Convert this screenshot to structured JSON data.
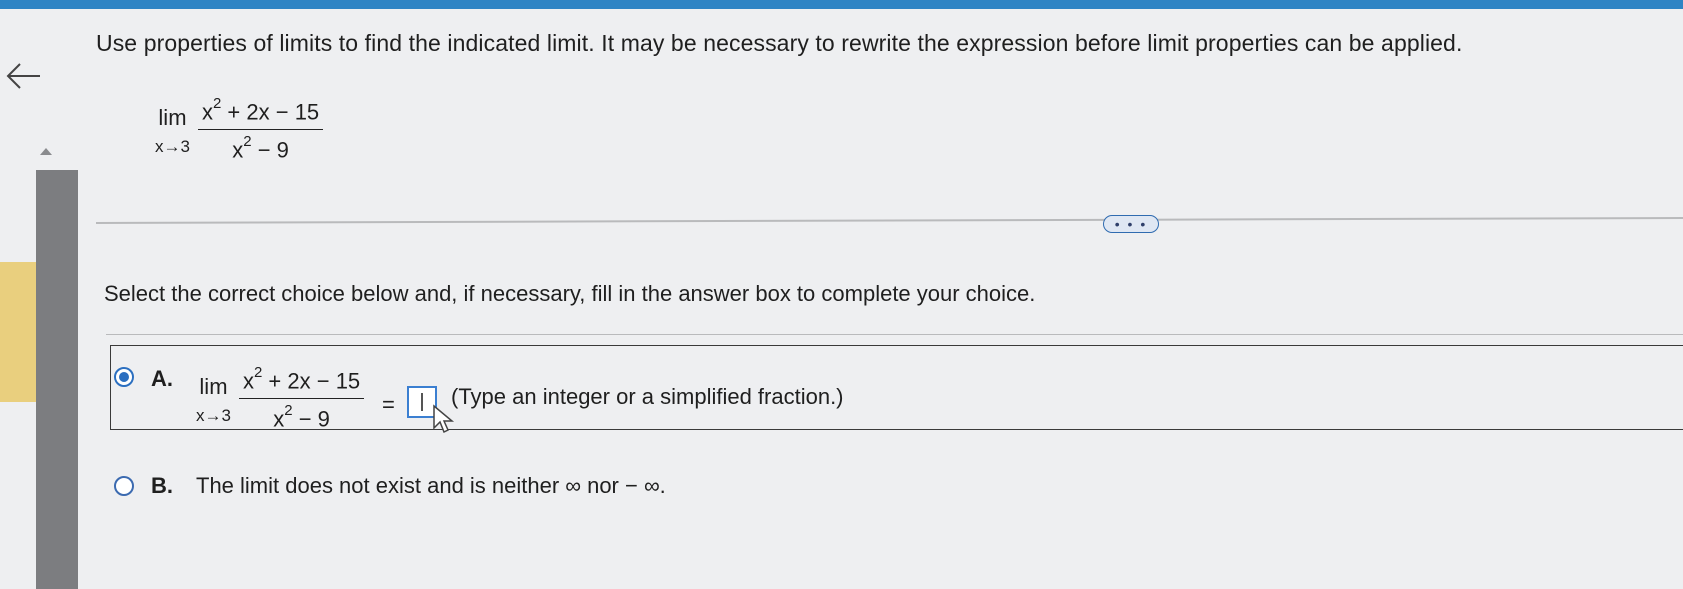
{
  "instruction": "Use properties of limits to find the indicated limit. It may be necessary to rewrite the expression before limit properties can be applied.",
  "problem": {
    "lim": "lim",
    "approach": "x→3",
    "num_base": "x",
    "num_exp": "2",
    "num_rest": " + 2x − 15",
    "den_base": "x",
    "den_exp": "2",
    "den_rest": " − 9"
  },
  "more_button": "• • •",
  "select_prompt": "Select the correct choice below and, if necessary, fill in the answer box to complete your choice.",
  "choices": {
    "a": {
      "letter": "A.",
      "selected": true,
      "equals": "=",
      "answer_value": "",
      "hint": "(Type an integer or a simplified fraction.)"
    },
    "b": {
      "letter": "B.",
      "selected": false,
      "text": "The limit does not exist and is neither ∞ nor − ∞."
    }
  },
  "colors": {
    "accent": "#2b6fc0",
    "topbar": "#2f84c4"
  }
}
